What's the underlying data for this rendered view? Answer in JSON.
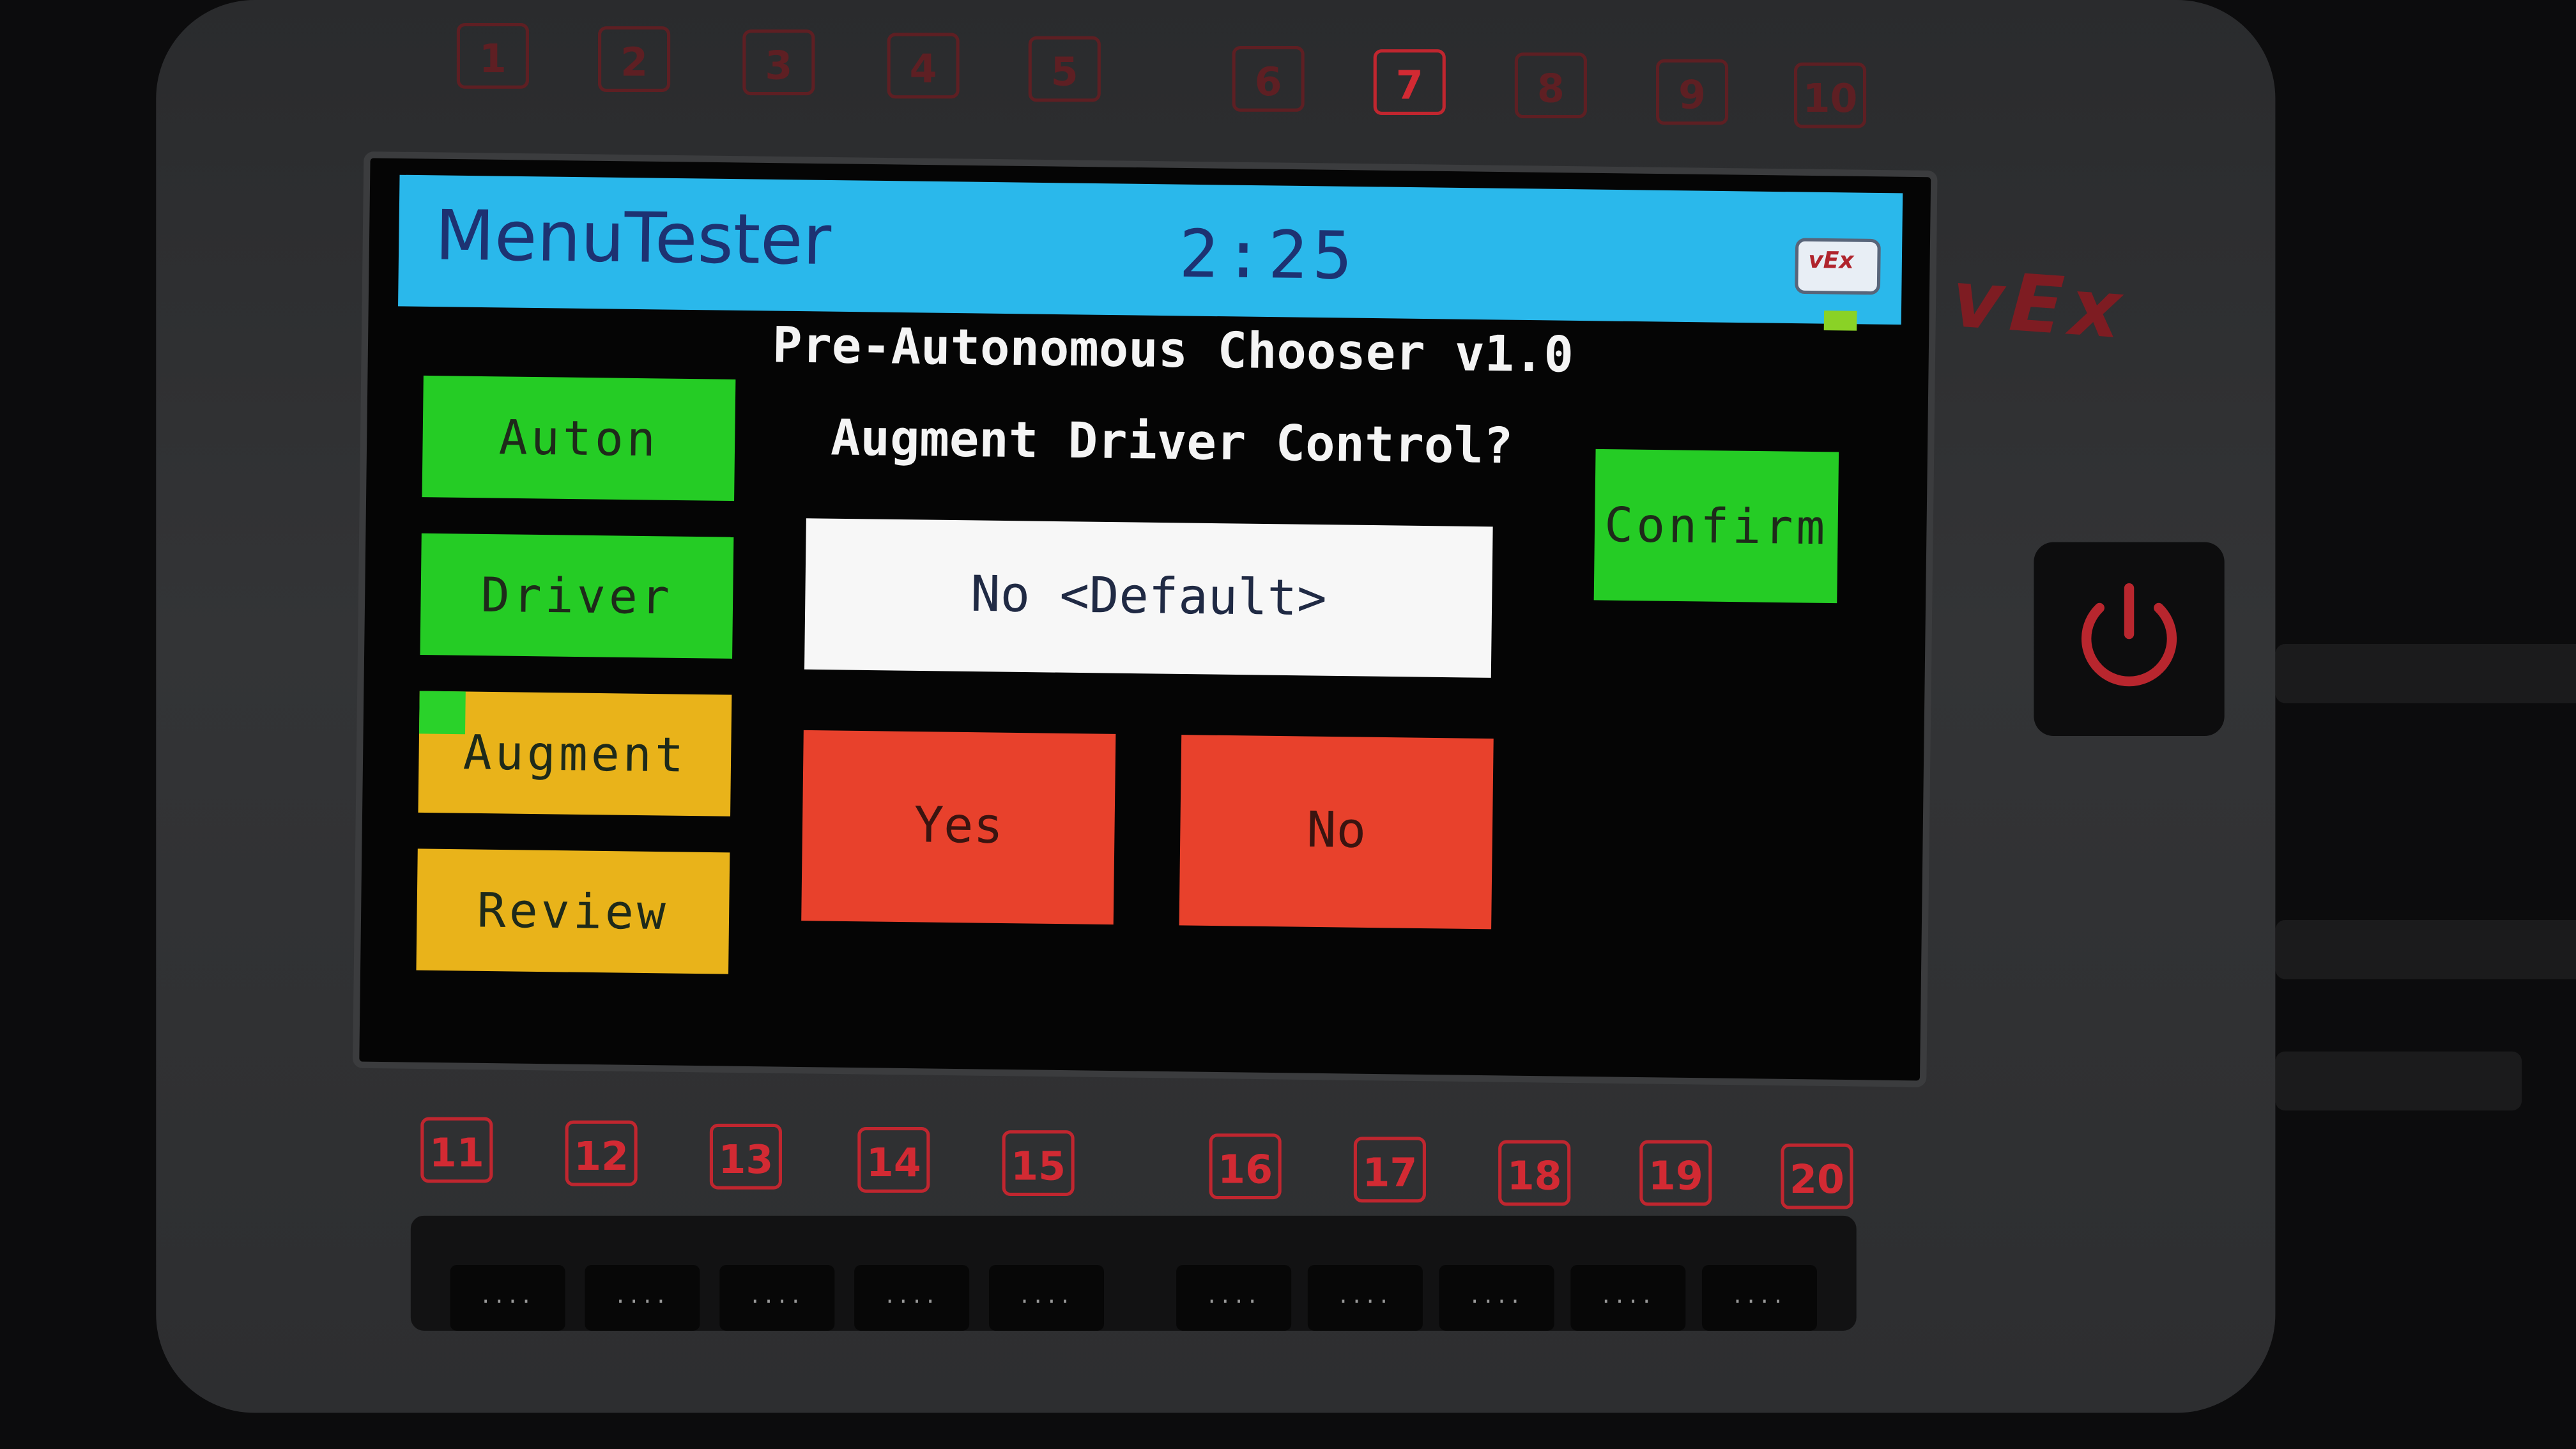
{
  "device": {
    "brand_logo": "vEx",
    "top_ports": [
      "1",
      "2",
      "3",
      "4",
      "5",
      "6",
      "7",
      "8",
      "9",
      "10"
    ],
    "bottom_ports": [
      "11",
      "12",
      "13",
      "14",
      "15",
      "16",
      "17",
      "18",
      "19",
      "20"
    ],
    "port_pins": "....",
    "power_icon": "power-icon",
    "accent_color": "#d22a33"
  },
  "screen": {
    "app_title": "MenuTester",
    "timer": "2:25",
    "badge_text": "vEx",
    "header": "Pre-Autonomous Chooser v1.0",
    "prompt": "Augment Driver Control?",
    "current_value": "No <Default>"
  },
  "menu": {
    "items": [
      {
        "label": "Auton",
        "color": "#25cc25"
      },
      {
        "label": "Driver",
        "color": "#25cc25"
      },
      {
        "label": "Augment",
        "color": "#e9b31a",
        "selected": true
      },
      {
        "label": "Review",
        "color": "#e9b31a"
      }
    ]
  },
  "choices": {
    "yes_label": "Yes",
    "no_label": "No",
    "color": "#e8412c"
  },
  "actions": {
    "confirm_label": "Confirm",
    "color": "#25cc25"
  }
}
